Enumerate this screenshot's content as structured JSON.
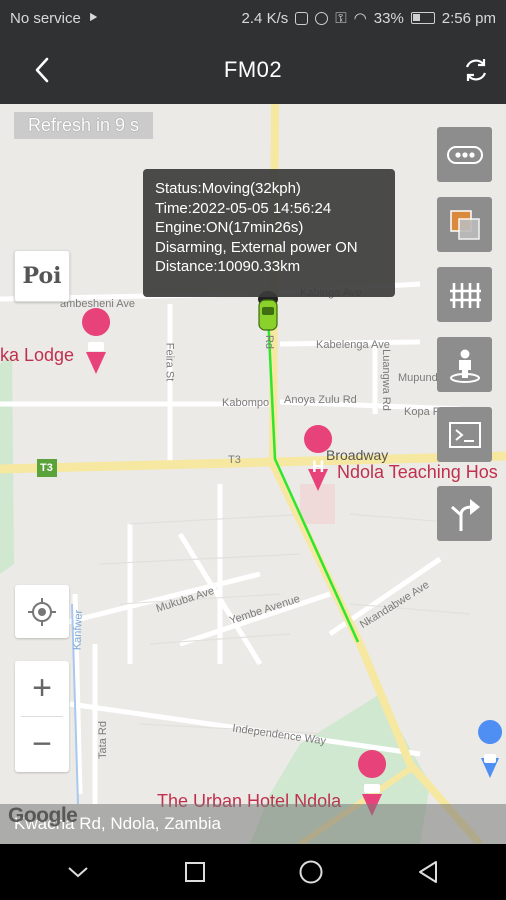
{
  "status_bar": {
    "carrier": "No service",
    "speed": "2.4 K/s",
    "battery": "33%",
    "time": "2:56 pm"
  },
  "header": {
    "title": "FM02"
  },
  "map": {
    "refresh_text": "Refresh in 9 s",
    "popup": {
      "status": "Status:Moving(32kph)",
      "time": "Time:2022-05-05 14:56:24",
      "engine": "Engine:ON(17min26s)",
      "power": "Disarming, External power ON",
      "distance": "Distance:10090.33km"
    },
    "poi_button": "Poi",
    "places": {
      "lodge": "ka Lodge",
      "hospital": "Ndola Teaching Hos",
      "broadway": "Broadway",
      "urban_hotel": "The Urban Hotel Ndola"
    },
    "streets": {
      "kabinga": "Kabinga Ave",
      "vimbesheni": "ambesheni Ave",
      "kabelenga": "Kabelenga Ave",
      "feira": "Feira St",
      "luangwa": "Luangwa Rd",
      "mupundu": "Mupundu",
      "kabompo": "Kabompo",
      "anoya": "Anoya Zulu Rd",
      "kopa": "Kopa Rd",
      "t3_road": "T3",
      "t3_badge": "T3",
      "mukuba": "Mukuba Ave",
      "yembe": "Yembe Avenue",
      "nkandabwe": "Nkandabwe Ave",
      "independence": "Independence Way",
      "tata": "Tata Rd",
      "kanfwer": "Kanfwer",
      "rd": "Rd"
    },
    "address": "Kwacha Rd, Ndola, Zambia",
    "google_logo": "Google",
    "zoom_in": "+",
    "zoom_out": "−"
  },
  "colors": {
    "track": "#2ee62e",
    "header_bg": "#2f3133",
    "side_button_bg": "#8d8d8d",
    "poi_pink": "#e8427a"
  }
}
